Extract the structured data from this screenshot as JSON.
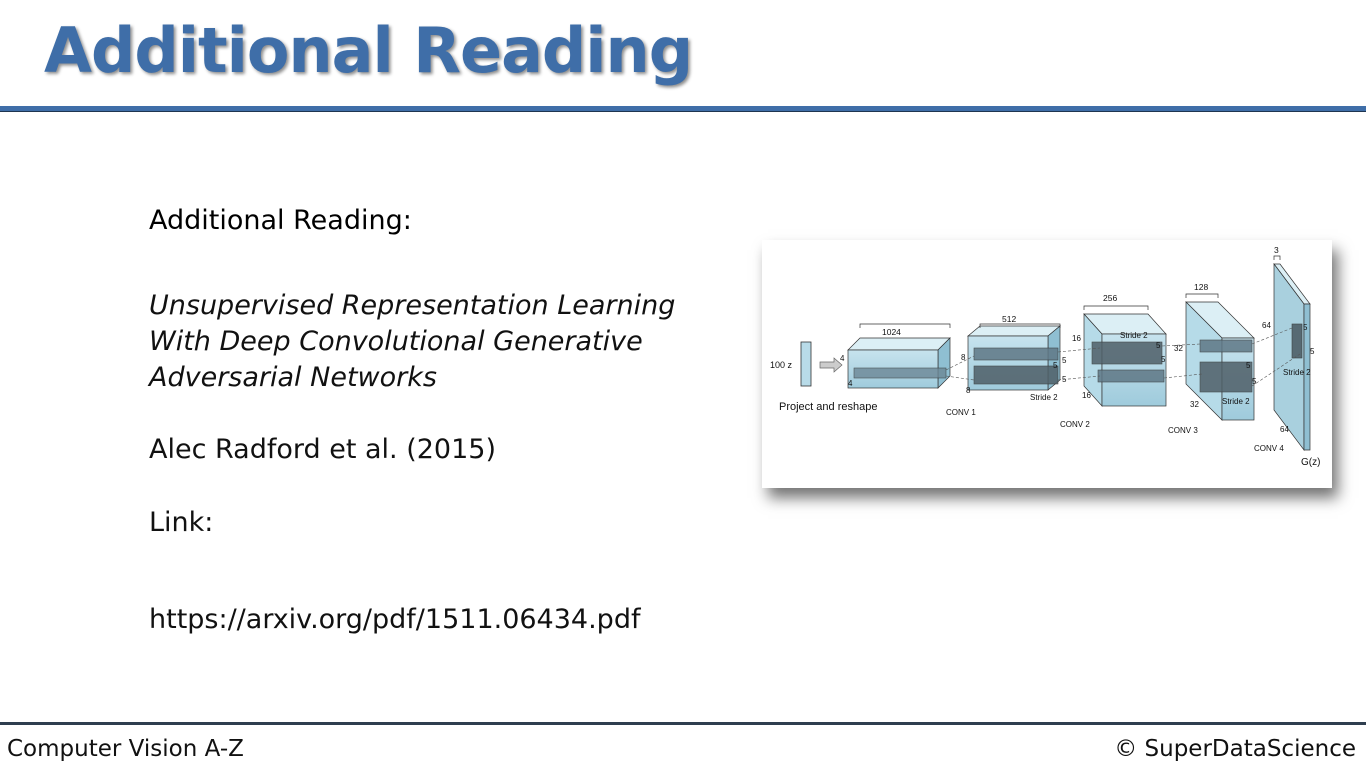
{
  "slide": {
    "title": "Additional Reading",
    "heading": "Additional Reading:",
    "paper_title_lines": [
      "Unsupervised Representation Learning",
      "With Deep Convolutional Generative",
      "Adversarial Networks"
    ],
    "authors": "Alec Radford et al. (2015)",
    "link_label": "Link:",
    "link_url": "https://arxiv.org/pdf/1511.06434.pdf"
  },
  "figure": {
    "input_label": "100 z",
    "project_label": "Project and reshape",
    "layers": [
      "CONV 1",
      "CONV 2",
      "CONV 3",
      "CONV 4"
    ],
    "output_label": "G(z)",
    "depths": [
      "1024",
      "512",
      "256",
      "128",
      "3"
    ],
    "stride_label": "Stride 2",
    "dims": [
      "4",
      "4",
      "8",
      "8",
      "16",
      "16",
      "32",
      "32",
      "64",
      "64",
      "5",
      "5"
    ]
  },
  "footer": {
    "left": "Computer Vision A-Z",
    "right": "© SuperDataScience"
  }
}
